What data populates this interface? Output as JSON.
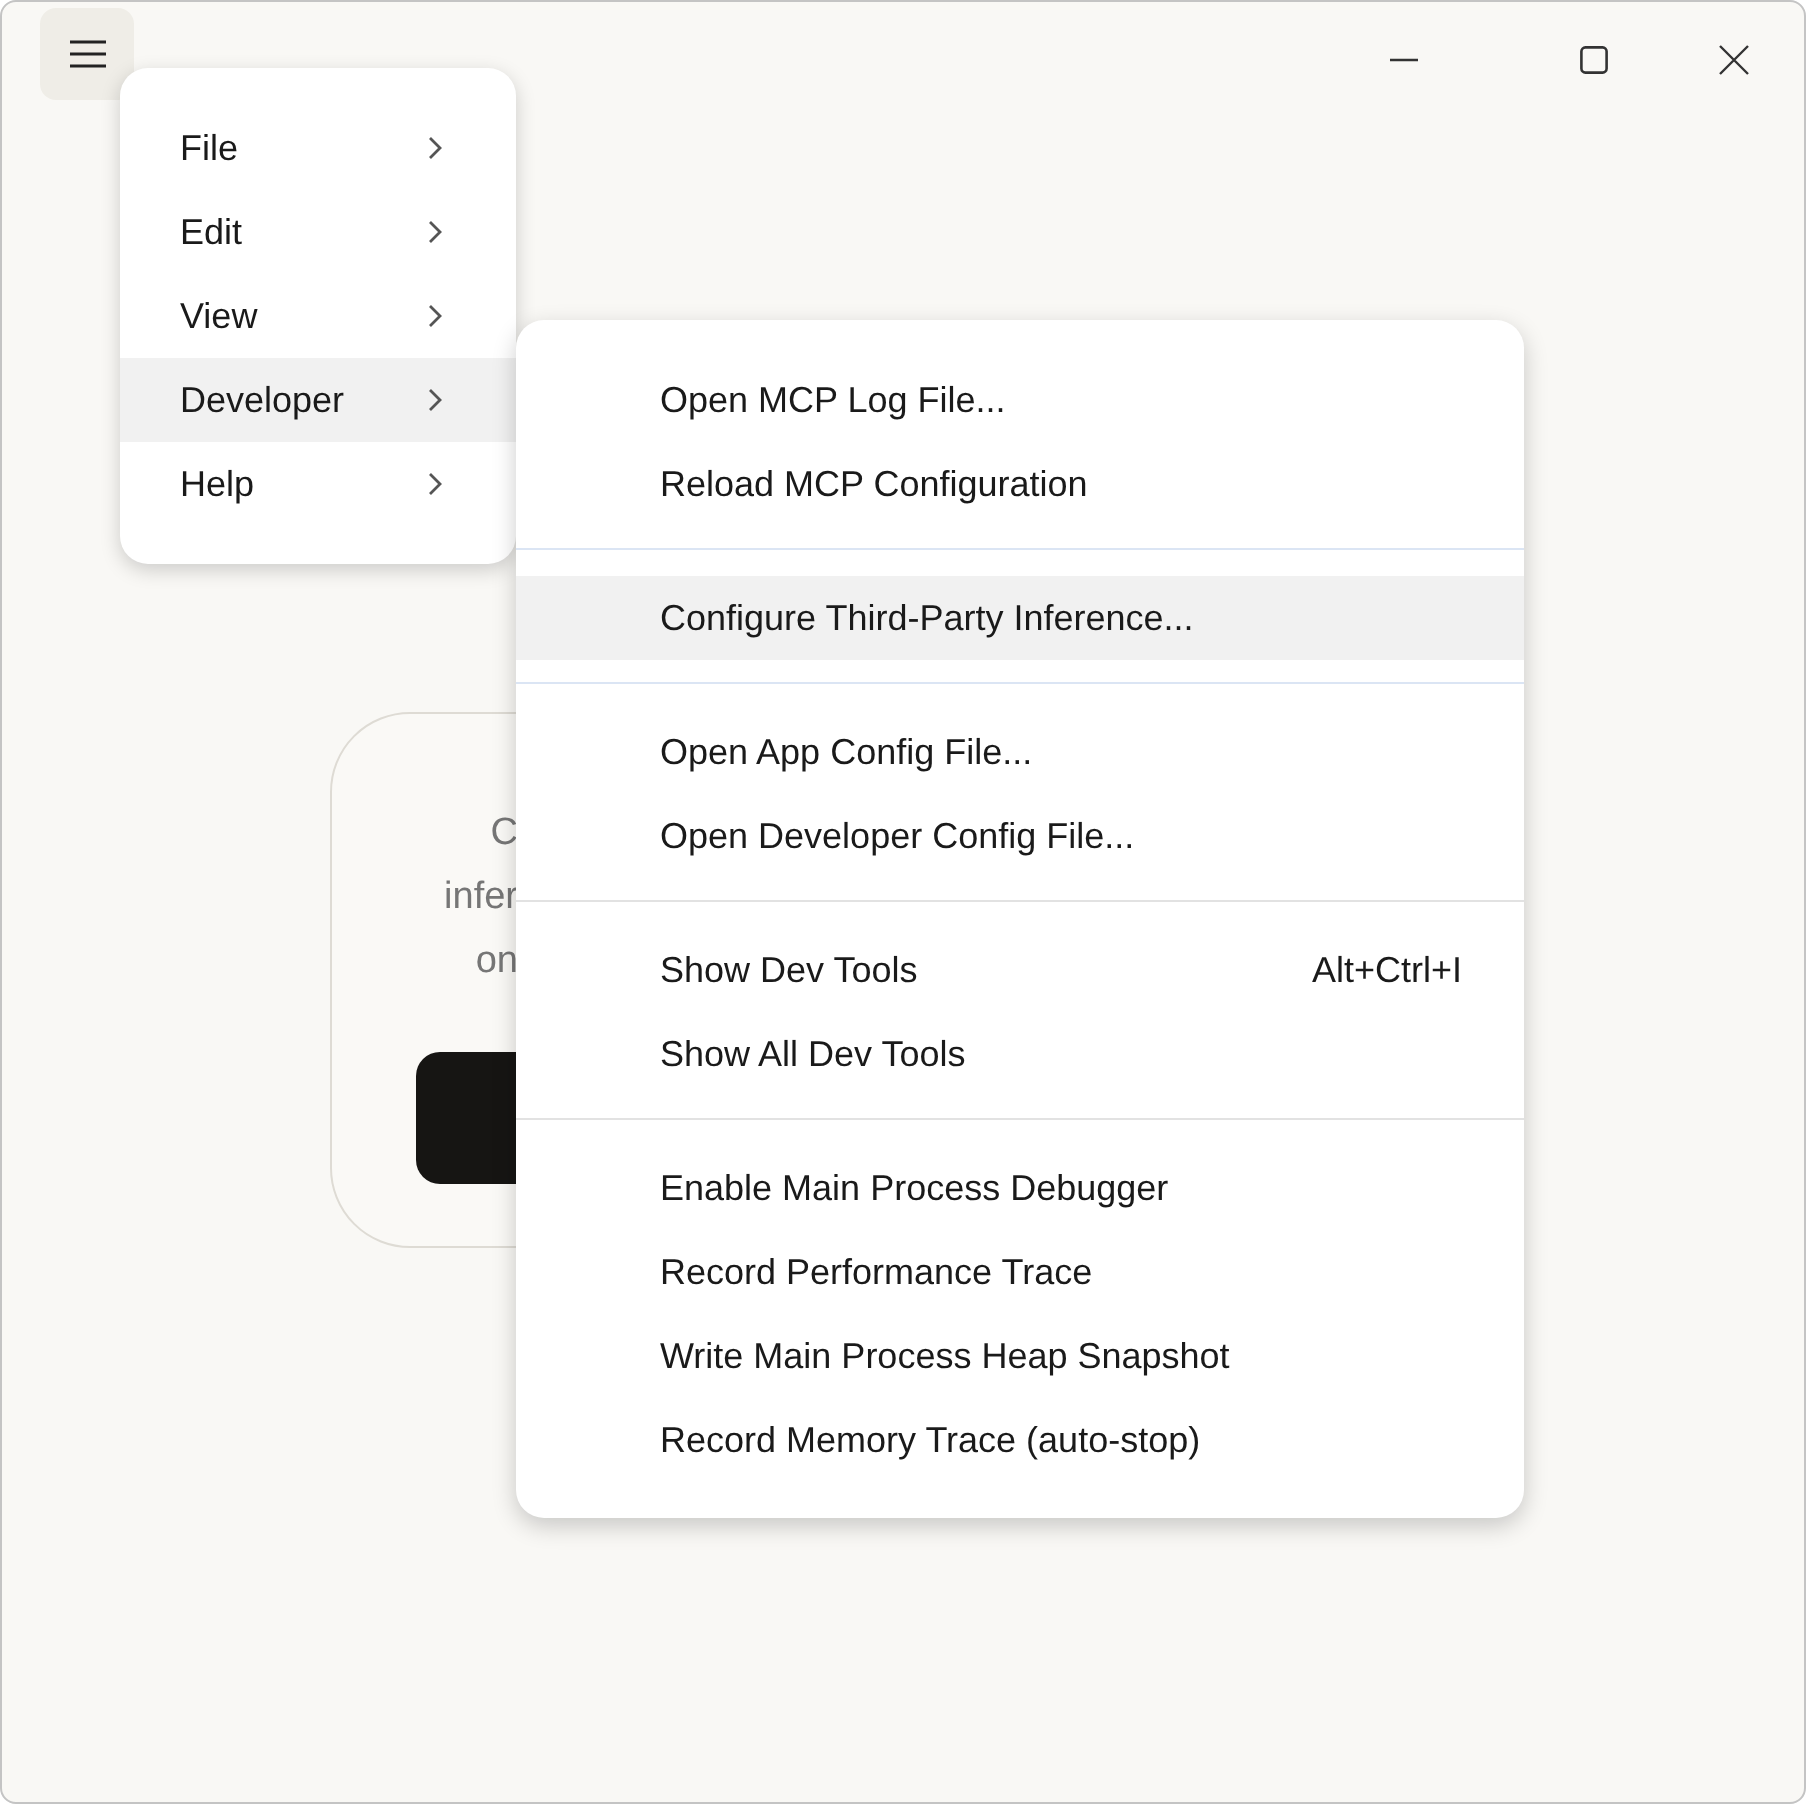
{
  "card": {
    "lines": [
      "C",
      "infer",
      "on"
    ]
  },
  "menu": {
    "items": [
      {
        "label": "File",
        "selected": false
      },
      {
        "label": "Edit",
        "selected": false
      },
      {
        "label": "View",
        "selected": false
      },
      {
        "label": "Developer",
        "selected": true
      },
      {
        "label": "Help",
        "selected": false
      }
    ]
  },
  "submenu": {
    "groups": [
      {
        "items": [
          {
            "label": "Open MCP Log File...",
            "selected": false
          },
          {
            "label": "Reload MCP Configuration",
            "selected": false
          }
        ]
      },
      {
        "items": [
          {
            "label": "Configure Third-Party Inference...",
            "selected": true
          }
        ]
      },
      {
        "items": [
          {
            "label": "Open App Config File...",
            "selected": false
          },
          {
            "label": "Open Developer Config File...",
            "selected": false
          }
        ]
      },
      {
        "items": [
          {
            "label": "Show Dev Tools",
            "shortcut": "Alt+Ctrl+I",
            "selected": false
          },
          {
            "label": "Show All Dev Tools",
            "selected": false
          }
        ]
      },
      {
        "items": [
          {
            "label": "Enable Main Process Debugger",
            "selected": false
          },
          {
            "label": "Record Performance Trace",
            "selected": false
          },
          {
            "label": "Write Main Process Heap Snapshot",
            "selected": false
          },
          {
            "label": "Record Memory Trace (auto-stop)",
            "selected": false
          }
        ]
      }
    ]
  }
}
